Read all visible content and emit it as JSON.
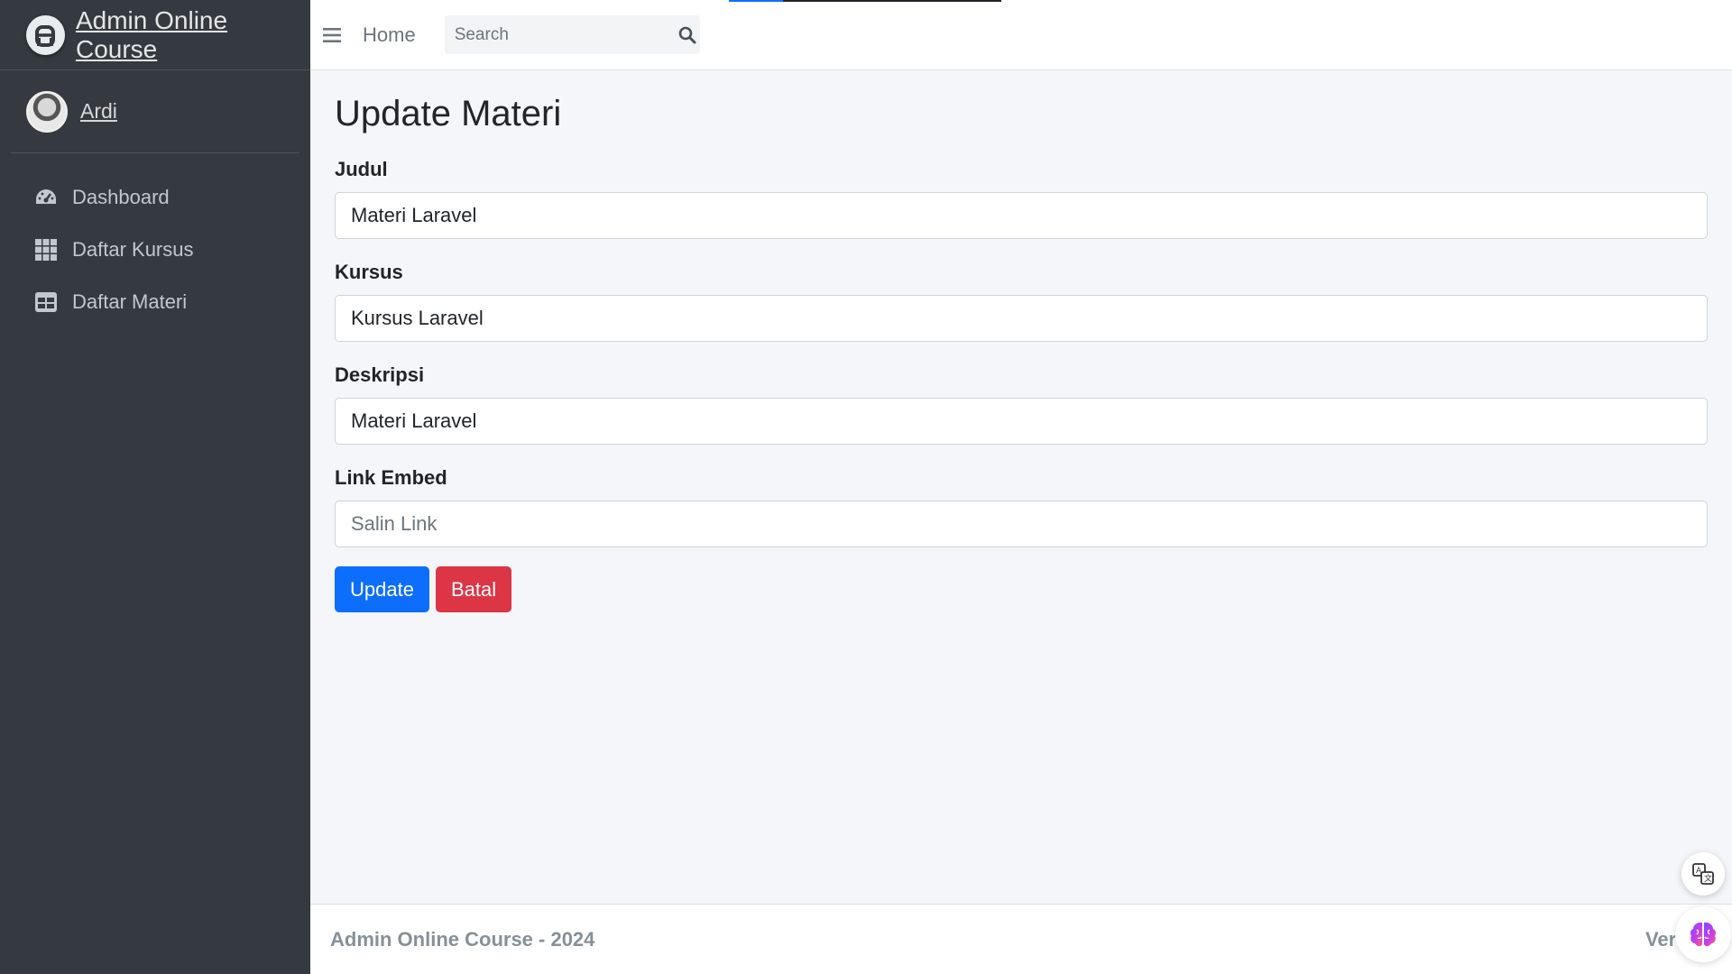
{
  "brand": {
    "title": "Admin Online Course",
    "logo_icon": "brand-logo-icon"
  },
  "user": {
    "name": "Ardi"
  },
  "sidebar": {
    "items": [
      {
        "label": "Dashboard",
        "icon": "tachometer-icon"
      },
      {
        "label": "Daftar Kursus",
        "icon": "grid-icon"
      },
      {
        "label": "Daftar Materi",
        "icon": "table-icon"
      }
    ]
  },
  "topbar": {
    "home_label": "Home",
    "search_placeholder": "Search"
  },
  "page": {
    "title": "Update Materi"
  },
  "form": {
    "judul_label": "Judul",
    "judul_value": "Materi Laravel",
    "kursus_label": "Kursus",
    "kursus_value": "Kursus Laravel",
    "deskripsi_label": "Deskripsi",
    "deskripsi_value": "Materi Laravel",
    "link_label": "Link Embed",
    "link_value": "",
    "link_placeholder": "Salin Link",
    "update_label": "Update",
    "cancel_label": "Batal"
  },
  "footer": {
    "left_text": "Admin Online Course - 2024",
    "right_text": "Versio"
  },
  "colors": {
    "sidebar_bg": "#343a40",
    "primary": "#0d6efd",
    "danger": "#dc3545",
    "content_bg": "#f4f6f9"
  }
}
